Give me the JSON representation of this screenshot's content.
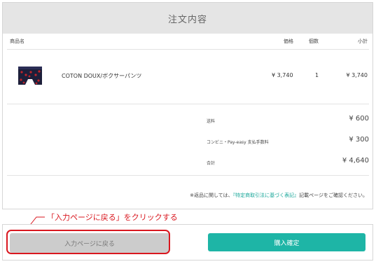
{
  "order": {
    "title": "注文内容",
    "columns": {
      "product": "商品名",
      "price": "価格",
      "quantity": "個数",
      "subtotal": "小計"
    },
    "items": [
      {
        "name": "COTON DOUX/ボクサーパンツ",
        "price": "¥ 3,740",
        "quantity": "1",
        "subtotal": "¥ 3,740",
        "thumbnail": "boxer-briefs-product-image"
      }
    ],
    "summary": {
      "shipping_label": "送料",
      "shipping_value": "¥ 600",
      "fee_label": "コンビニ・Pay-easy 支払手数料",
      "fee_value": "¥ 300",
      "total_label": "合計",
      "total_value": "¥ 4,640"
    },
    "note_prefix": "※返品に関しては、",
    "note_link": "『特定商取引法に基づく表記』",
    "note_suffix": "記載ページをご確認ください。"
  },
  "actions": {
    "back_label": "入力ページに戻る",
    "confirm_label": "購入確定"
  },
  "annotation": {
    "callout": "「入力ページに戻る」をクリックする",
    "color": "#d9171f"
  },
  "colors": {
    "accent": "#1eb5a6",
    "header_bg": "#e5e5e5",
    "back_button_bg": "#cccccc"
  }
}
